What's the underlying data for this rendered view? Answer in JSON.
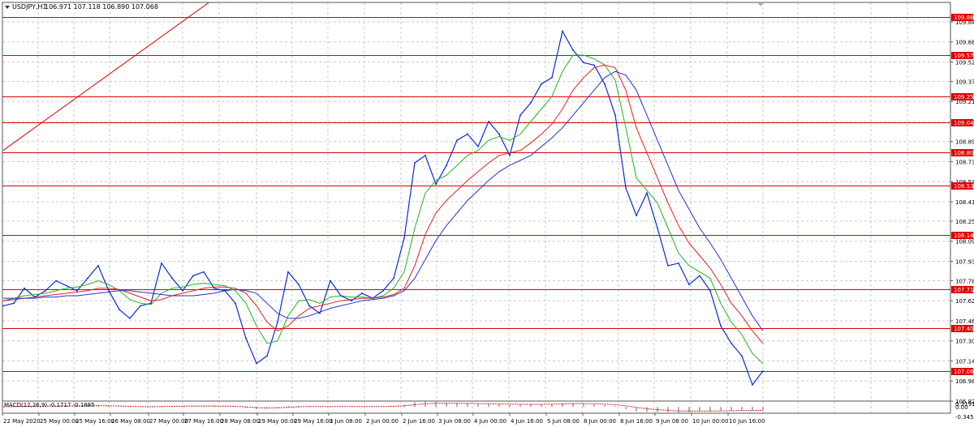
{
  "header": {
    "symbol_label": "USDJPY,H1",
    "ohlc_text": "106.971 107.118 106.890 107.068",
    "dropdown_icon": "triangle-down-icon"
  },
  "macd": {
    "label": "MACD(12,26,9) -0.1717 -0.1885",
    "axis_labels": [
      "0.3191",
      "0.00",
      "-0.3455"
    ]
  },
  "colors": {
    "background": "#ffffff",
    "grid": "#c9c9c9",
    "separator": "#888888",
    "price_line": "#0b2bd6",
    "ma_green": "#22b422",
    "ma_red": "#e02020",
    "ma_blue": "#2233cc",
    "level_line": "#e00000",
    "level_label_bg": "#e00000",
    "level_label_text": "#ffffff",
    "macd_hist": "#999999",
    "macd_signal": "#d02020"
  },
  "chart_data": {
    "type": "line",
    "symbol": "USDJPY",
    "timeframe": "H1",
    "ylim": [
      106.82,
      110.0
    ],
    "y_tick_labels": [
      "109.845",
      "109.685",
      "109.525",
      "109.370",
      "109.210",
      "109.050",
      "108.890",
      "108.730",
      "108.570",
      "108.410",
      "108.255",
      "108.095",
      "107.935",
      "107.780",
      "107.620",
      "107.460",
      "107.300",
      "107.140",
      "106.980",
      "106.820"
    ],
    "x_tick_labels": [
      "22 May 2020",
      "25 May 00:00",
      "25 May 16:00",
      "26 May 08:00",
      "27 May 00:00",
      "27 May 16:00",
      "28 May 08:00",
      "29 May 00:00",
      "29 May 16:00",
      "1 Jun 08:00",
      "2 Jun 00:00",
      "2 Jun 16:00",
      "3 Jun 08:00",
      "4 Jun 00:00",
      "4 Jun 16:00",
      "5 Jun 08:00",
      "8 Jun 00:00",
      "8 Jun 16:00",
      "9 Jun 08:00",
      "10 Jun 00:00",
      "10 Jun 16:00"
    ],
    "horizontal_levels": [
      "109.882",
      "109.578",
      "109.253",
      "109.041",
      "108.805",
      "108.537",
      "108.148",
      "107.710",
      "107.402",
      "107.062"
    ],
    "series": [
      {
        "values": [
          107.58,
          107.6,
          107.72,
          107.65,
          107.7,
          107.78,
          107.74,
          107.7,
          107.8,
          107.9,
          107.7,
          107.55,
          107.48,
          107.58,
          107.6,
          107.92,
          107.8,
          107.7,
          107.82,
          107.85,
          107.72,
          107.7,
          107.6,
          107.32,
          107.12,
          107.18,
          107.45,
          107.85,
          107.75,
          107.58,
          107.52,
          107.78,
          107.66,
          107.62,
          107.68,
          107.64,
          107.7,
          107.8,
          108.12,
          108.72,
          108.78,
          108.55,
          108.7,
          108.9,
          108.95,
          108.85,
          109.05,
          108.95,
          108.78,
          109.1,
          109.2,
          109.35,
          109.4,
          109.77,
          109.62,
          109.52,
          109.5,
          109.35,
          109.1,
          108.52,
          108.3,
          108.48,
          108.2,
          107.9,
          107.92,
          107.75,
          107.82,
          107.7,
          107.42,
          107.28,
          107.18,
          106.95,
          107.06
        ]
      },
      {
        "values": [
          107.62,
          107.64,
          107.66,
          107.67,
          107.68,
          107.7,
          107.72,
          107.73,
          107.75,
          107.78,
          107.75,
          107.7,
          107.63,
          107.6,
          107.59,
          107.68,
          107.72,
          107.73,
          107.75,
          107.76,
          107.75,
          107.74,
          107.7,
          107.6,
          107.42,
          107.28,
          107.3,
          107.5,
          107.62,
          107.63,
          107.6,
          107.65,
          107.66,
          107.65,
          107.65,
          107.64,
          107.66,
          107.72,
          107.85,
          108.2,
          108.48,
          108.58,
          108.62,
          108.7,
          108.78,
          108.82,
          108.9,
          108.93,
          108.9,
          108.95,
          109.05,
          109.15,
          109.25,
          109.45,
          109.58,
          109.58,
          109.55,
          109.5,
          109.38,
          109.0,
          108.6,
          108.5,
          108.4,
          108.2,
          108.0,
          107.9,
          107.85,
          107.8,
          107.6,
          107.45,
          107.35,
          107.2,
          107.12
        ]
      },
      {
        "values": [
          107.62,
          107.63,
          107.64,
          107.65,
          107.66,
          107.67,
          107.68,
          107.69,
          107.7,
          107.72,
          107.72,
          107.71,
          107.68,
          107.65,
          107.62,
          107.63,
          107.66,
          107.68,
          107.7,
          107.72,
          107.73,
          107.73,
          107.72,
          107.68,
          107.58,
          107.45,
          107.38,
          107.42,
          107.5,
          107.56,
          107.58,
          107.6,
          107.62,
          107.63,
          107.64,
          107.64,
          107.65,
          107.67,
          107.72,
          107.9,
          108.15,
          108.32,
          108.42,
          108.5,
          108.58,
          108.65,
          108.72,
          108.78,
          108.8,
          108.82,
          108.88,
          108.95,
          109.03,
          109.15,
          109.3,
          109.4,
          109.48,
          109.5,
          109.48,
          109.3,
          109.0,
          108.8,
          108.6,
          108.4,
          108.22,
          108.08,
          107.98,
          107.88,
          107.75,
          107.6,
          107.5,
          107.38,
          107.28
        ]
      },
      {
        "values": [
          107.64,
          107.64,
          107.64,
          107.64,
          107.65,
          107.65,
          107.66,
          107.66,
          107.67,
          107.68,
          107.69,
          107.7,
          107.7,
          107.69,
          107.68,
          107.67,
          107.66,
          107.66,
          107.66,
          107.67,
          107.68,
          107.7,
          107.71,
          107.7,
          107.68,
          107.6,
          107.52,
          107.48,
          107.48,
          107.5,
          107.53,
          107.56,
          107.58,
          107.6,
          107.62,
          107.63,
          107.64,
          107.66,
          107.7,
          107.8,
          107.95,
          108.1,
          108.22,
          108.32,
          108.42,
          108.5,
          108.58,
          108.65,
          108.7,
          108.74,
          108.78,
          108.85,
          108.92,
          109.0,
          109.1,
          109.2,
          109.3,
          109.4,
          109.45,
          109.42,
          109.3,
          109.1,
          108.9,
          108.7,
          108.5,
          108.35,
          108.2,
          108.08,
          107.95,
          107.8,
          107.65,
          107.5,
          107.38
        ]
      }
    ],
    "macd_histogram": [
      0.02,
      0.03,
      0.05,
      0.06,
      0.05,
      0.04,
      0.05,
      0.06,
      0.07,
      0.08,
      0.06,
      0.02,
      -0.02,
      -0.01,
      0.0,
      0.05,
      0.06,
      0.05,
      0.06,
      0.07,
      0.05,
      0.03,
      0.0,
      -0.06,
      -0.12,
      -0.1,
      -0.04,
      0.05,
      0.06,
      0.04,
      0.02,
      0.03,
      0.03,
      0.02,
      0.02,
      0.02,
      0.03,
      0.05,
      0.12,
      0.26,
      0.3,
      0.25,
      0.22,
      0.2,
      0.19,
      0.17,
      0.16,
      0.15,
      0.12,
      0.13,
      0.14,
      0.15,
      0.16,
      0.2,
      0.22,
      0.18,
      0.14,
      0.1,
      0.05,
      -0.12,
      -0.25,
      -0.27,
      -0.28,
      -0.3,
      -0.3,
      -0.28,
      -0.26,
      -0.24,
      -0.22,
      -0.2,
      -0.19,
      -0.18,
      -0.17
    ],
    "macd_signal": [
      0.01,
      0.02,
      0.03,
      0.04,
      0.04,
      0.04,
      0.05,
      0.05,
      0.06,
      0.06,
      0.06,
      0.05,
      0.03,
      0.02,
      0.01,
      0.02,
      0.03,
      0.04,
      0.05,
      0.05,
      0.05,
      0.04,
      0.03,
      0.0,
      -0.04,
      -0.06,
      -0.05,
      -0.02,
      0.01,
      0.02,
      0.02,
      0.02,
      0.02,
      0.02,
      0.02,
      0.02,
      0.02,
      0.03,
      0.06,
      0.12,
      0.17,
      0.2,
      0.2,
      0.2,
      0.19,
      0.18,
      0.17,
      0.16,
      0.15,
      0.14,
      0.14,
      0.14,
      0.15,
      0.16,
      0.18,
      0.18,
      0.17,
      0.15,
      0.12,
      0.06,
      -0.03,
      -0.1,
      -0.15,
      -0.19,
      -0.22,
      -0.23,
      -0.23,
      -0.23,
      -0.22,
      -0.21,
      -0.2,
      -0.19,
      -0.19
    ],
    "macd_ylim": [
      -0.3455,
      0.3191
    ],
    "trendline_from": [
      0,
      108.82
    ],
    "trendline_to": [
      19.5,
      110.0
    ],
    "grid": true
  }
}
